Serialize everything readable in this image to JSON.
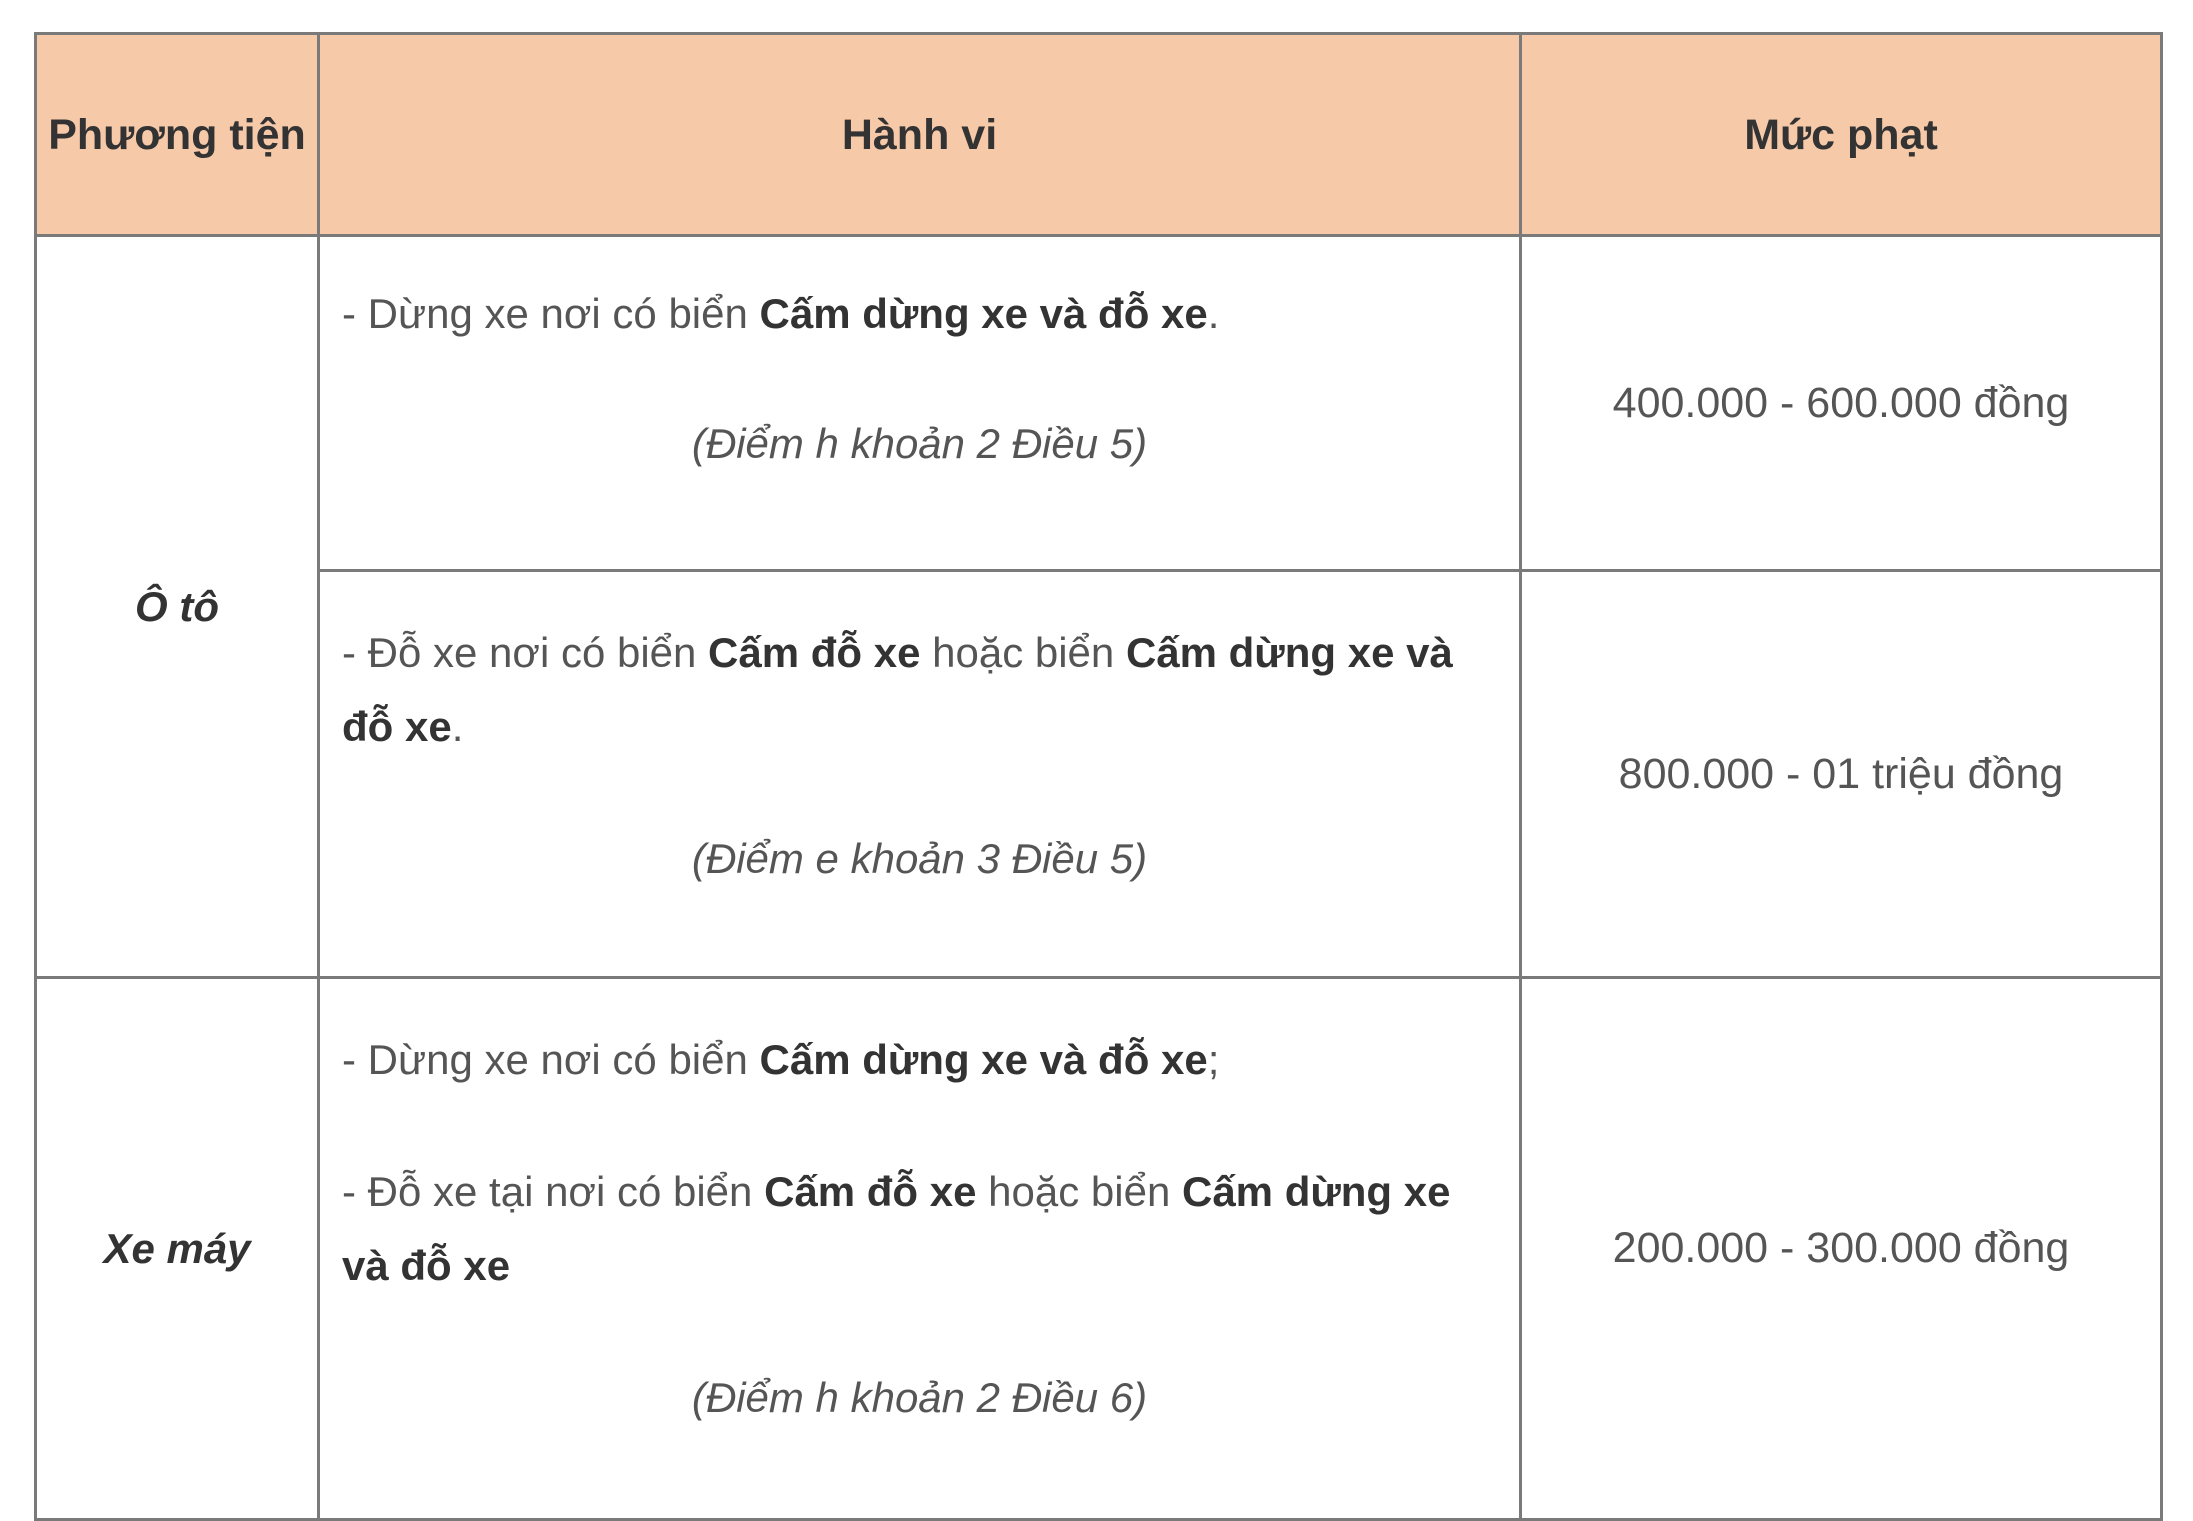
{
  "table": {
    "headers": {
      "vehicle": "Phương tiện",
      "behavior": "Hành vi",
      "fine": "Mức phạt"
    },
    "rows": [
      {
        "vehicle": "Ô tô",
        "violations": [
          {
            "prefix": "- Dừng xe nơi có biển ",
            "bold": "Cấm dừng xe và đỗ xe",
            "suffix": ".",
            "citation": "(Điểm h khoản 2 Điều 5)",
            "fine": "400.000 - 600.000 đồng"
          },
          {
            "prefix": "- Đỗ xe nơi có biển ",
            "bold1": "Cấm đỗ xe",
            "middle": " hoặc biển ",
            "bold2": "Cấm dừng xe và đỗ xe",
            "suffix": ".",
            "citation": "(Điểm e khoản 3 Điều 5)",
            "fine": "800.000 - 01 triệu đồng"
          }
        ]
      },
      {
        "vehicle": "Xe máy",
        "violation": {
          "line1_prefix": "- Dừng xe nơi có biển ",
          "line1_bold": "Cấm dừng xe và đỗ xe",
          "line1_suffix": ";",
          "line2_prefix": "- Đỗ xe tại nơi có biển ",
          "line2_bold1": "Cấm đỗ xe",
          "line2_middle": " hoặc biển ",
          "line2_bold2": "Cấm dừng xe và đỗ xe",
          "citation": "(Điểm h khoản 2 Điều 6)",
          "fine": "200.000 - 300.000 đồng"
        }
      }
    ]
  },
  "colors": {
    "header_bg": "#f6c9a8",
    "border": "#7a7a7a",
    "text": "#555555",
    "text_bold": "#333333"
  }
}
